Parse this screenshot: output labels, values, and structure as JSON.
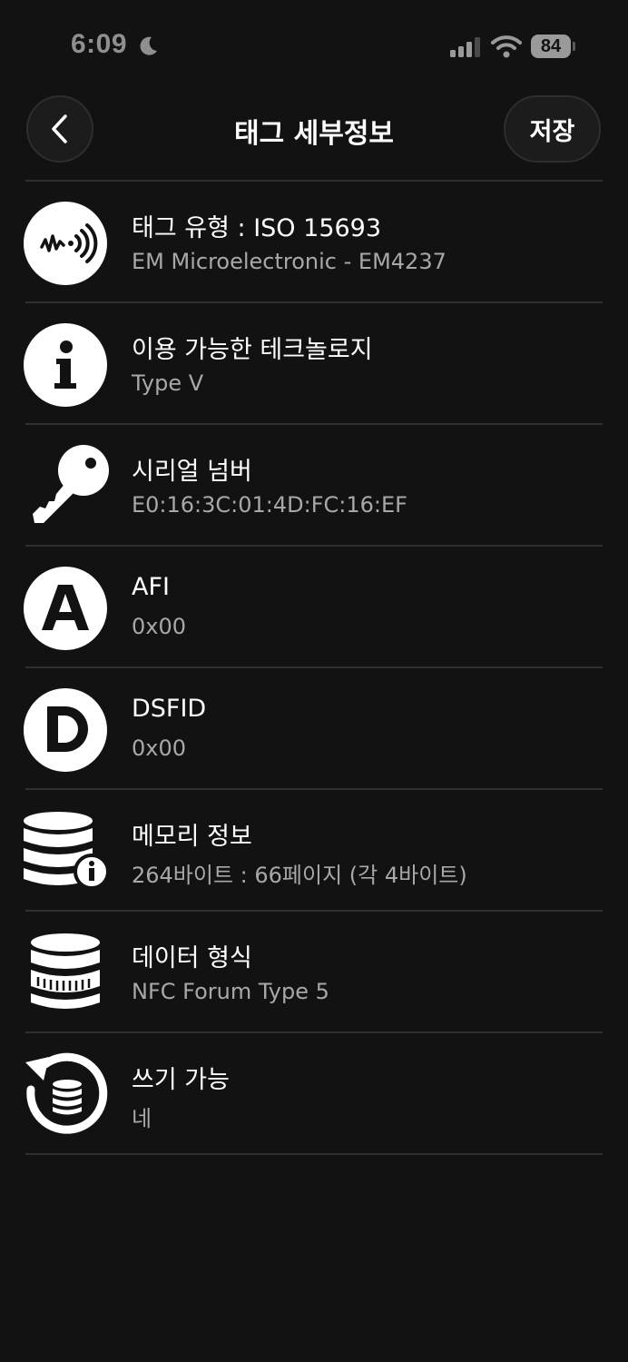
{
  "status_bar": {
    "time": "6:09",
    "battery": "84"
  },
  "header": {
    "title": "태그 세부정보",
    "save_label": "저장"
  },
  "items": [
    {
      "icon": "nfc-waves-icon",
      "title": "태그 유형 : ISO 15693",
      "value": "EM Microelectronic - EM4237"
    },
    {
      "icon": "info-icon",
      "title": "이용 가능한 테크놀로지",
      "value": "Type V"
    },
    {
      "icon": "key-icon",
      "title": "시리얼 넘버",
      "value": "E0:16:3C:01:4D:FC:16:EF"
    },
    {
      "icon": "letter-a-icon",
      "title": "AFI",
      "value": "0x00"
    },
    {
      "icon": "letter-d-icon",
      "title": "DSFID",
      "value": "0x00"
    },
    {
      "icon": "database-info-icon",
      "title": "메모리 정보",
      "value": "264바이트 : 66페이지 (각 4바이트)"
    },
    {
      "icon": "database-icon",
      "title": "데이터 형식",
      "value": "NFC Forum Type 5"
    },
    {
      "icon": "writable-icon",
      "title": "쓰기 가능",
      "value": "네"
    }
  ]
}
